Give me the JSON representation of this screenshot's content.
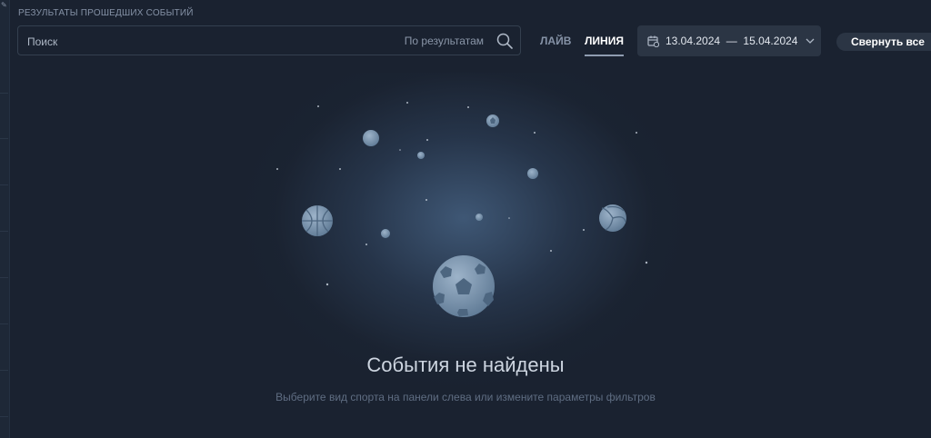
{
  "header": {
    "section_title": "РЕЗУЛЬТАТЫ ПРОШЕДШИХ СОБЫТИЙ"
  },
  "search": {
    "placeholder": "Поиск",
    "value": "",
    "scope_label": "По результатам",
    "icon": "search-icon"
  },
  "tabs": [
    {
      "label": "ЛАЙВ",
      "active": false
    },
    {
      "label": "ЛИНИЯ",
      "active": true
    }
  ],
  "date_range": {
    "from": "13.04.2024",
    "separator": "—",
    "to": "15.04.2024",
    "icon": "calendar-icon",
    "dropdown_icon": "chevron-down-icon"
  },
  "collapse_all_label": "Свернуть все",
  "empty_state": {
    "title": "События не найдены",
    "hint": "Выберите вид спорта на панели слева или измените параметры фильтров"
  },
  "colors": {
    "background": "#1a2230",
    "panel": "#2b3544",
    "ball": "#6f8ba6"
  }
}
